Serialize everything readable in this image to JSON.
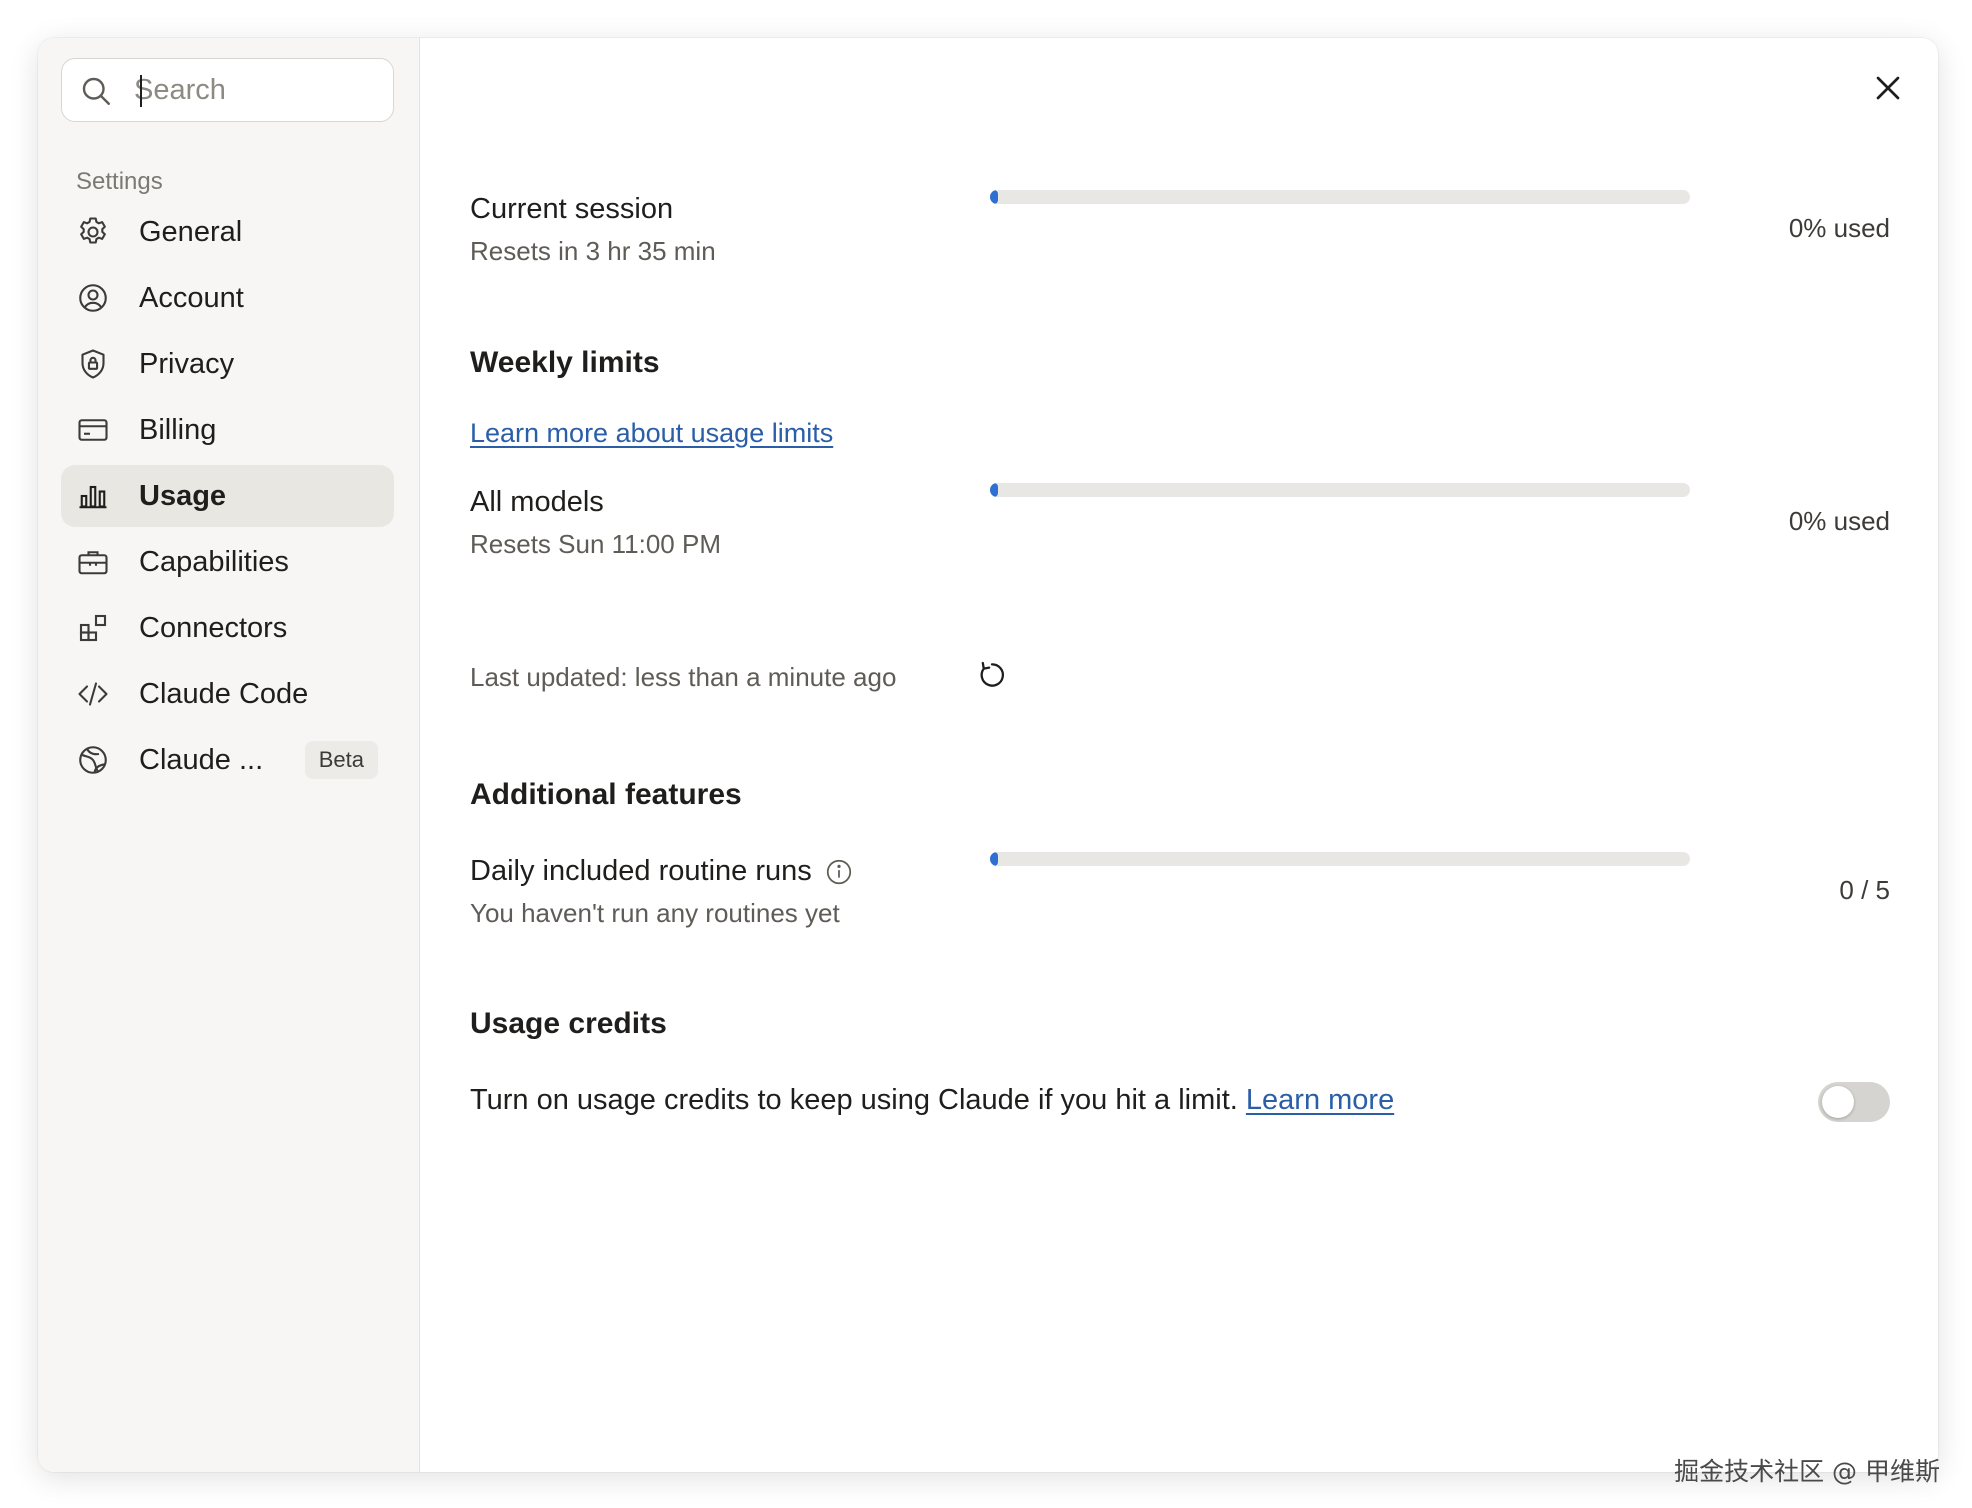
{
  "search": {
    "placeholder": "Search"
  },
  "sidebar": {
    "section_label": "Settings",
    "items": [
      {
        "label": "General",
        "icon": "gear-icon"
      },
      {
        "label": "Account",
        "icon": "user-circle-icon"
      },
      {
        "label": "Privacy",
        "icon": "shield-lock-icon"
      },
      {
        "label": "Billing",
        "icon": "credit-card-icon"
      },
      {
        "label": "Usage",
        "icon": "bar-chart-icon",
        "active": true
      },
      {
        "label": "Capabilities",
        "icon": "briefcase-icon"
      },
      {
        "label": "Connectors",
        "icon": "blocks-icon"
      },
      {
        "label": "Claude Code",
        "icon": "code-icon"
      },
      {
        "label": "Claude ...",
        "icon": "globe-icon",
        "badge": "Beta"
      }
    ]
  },
  "usage": {
    "current_session": {
      "title": "Current session",
      "subtitle": "Resets in 3 hr 35 min",
      "percent": 0,
      "value_label": "0% used"
    },
    "weekly_limits": {
      "title": "Weekly limits",
      "learn_more": "Learn more about usage limits",
      "all_models": {
        "title": "All models",
        "subtitle": "Resets Sun 11:00 PM",
        "percent": 0,
        "value_label": "0% used"
      }
    },
    "last_updated": "Last updated: less than a minute ago",
    "additional_features": {
      "title": "Additional features",
      "routine_runs": {
        "title": "Daily included routine runs",
        "subtitle": "You haven't run any routines yet",
        "used": 0,
        "total": 5,
        "value_label": "0 / 5"
      }
    },
    "usage_credits": {
      "title": "Usage credits",
      "description": "Turn on usage credits to keep using Claude if you hit a limit.",
      "link": "Learn more",
      "enabled": false
    }
  },
  "colors": {
    "accent_bar": "#2f6fd2",
    "link": "#2a5fa8",
    "active_nav_bg": "#e9e7e2"
  },
  "watermark": "掘金技术社区 @ 甲维斯"
}
